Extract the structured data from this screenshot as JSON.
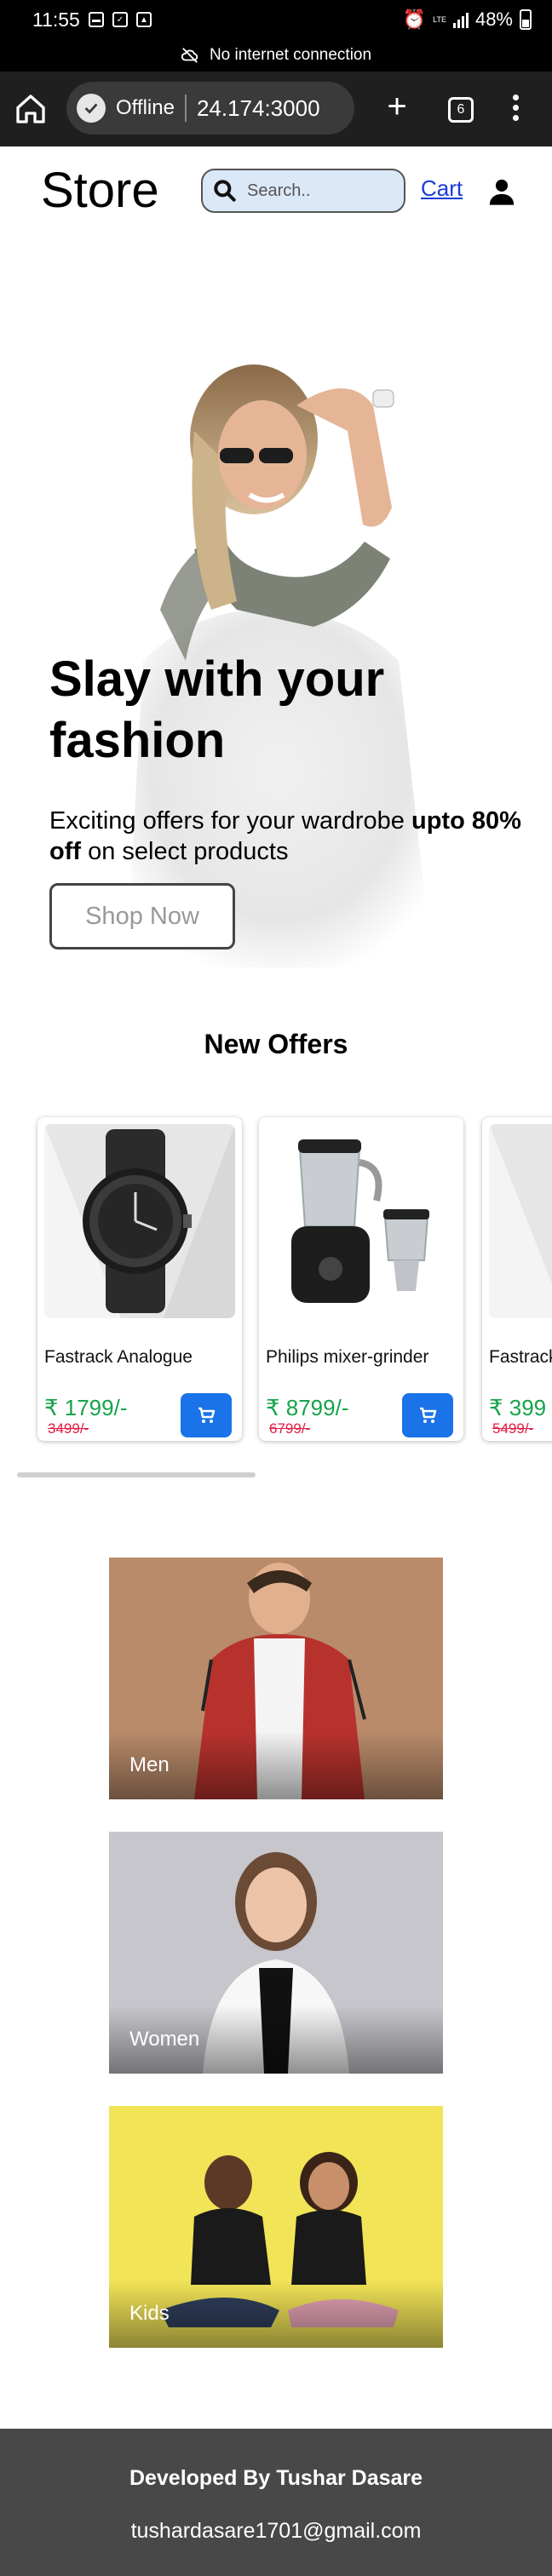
{
  "status_bar": {
    "time": "11:55",
    "battery": "48%",
    "network": "LTE"
  },
  "offline_banner": {
    "text": "No internet connection"
  },
  "browser": {
    "status": "Offline",
    "url": "24.174:3000",
    "tab_count": "6"
  },
  "header": {
    "logo": "Store",
    "search_placeholder": "Search..",
    "cart_label": "Cart"
  },
  "hero": {
    "title": "Slay with your fashion",
    "subtitle_start": "Exciting offers for your wardrobe ",
    "subtitle_bold": "upto 80% off",
    "subtitle_end": " on select products",
    "button": "Shop Now"
  },
  "offers": {
    "title": "New Offers",
    "products": [
      {
        "name": "Fastrack Analogue",
        "price": "₹ 1799/-",
        "old_price": "3499/-"
      },
      {
        "name": "Philips mixer-grinder",
        "price": "₹ 8799/-",
        "old_price": "6799/-"
      },
      {
        "name": "Fastrack",
        "price": "₹ 399",
        "old_price": "5499/-"
      }
    ]
  },
  "categories": [
    {
      "label": "Men"
    },
    {
      "label": "Women"
    },
    {
      "label": "Kids"
    }
  ],
  "footer": {
    "developer": "Developed By Tushar Dasare",
    "email": "tushardasare1701@gmail.com"
  },
  "colors": {
    "accent": "#1a73e8",
    "price": "#16a34a",
    "old_price": "#e11d48",
    "search_bg": "#dbe8f7",
    "footer_bg": "#484848"
  }
}
